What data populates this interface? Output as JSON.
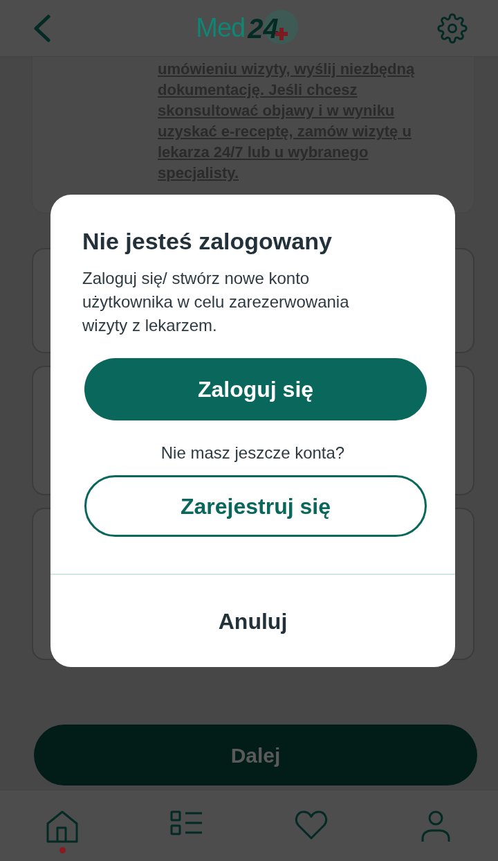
{
  "header": {
    "logo": {
      "text": "Med",
      "number": "24"
    }
  },
  "content": {
    "paragraph": "umówieniu wizyty, wyślij niezbędną dokumentację. Jeśli chcesz skonsultować objawy i w wyniku uzyskać e-receptę, zamów wizytę u lekarza 24/7 lub u wybranego specjalisty."
  },
  "dialog": {
    "title": "Nie jesteś zalogowany",
    "message": "Zaloguj się/ stwórz nowe konto użytkownika w celu zarezerwowania wizyty z lekarzem.",
    "primary_button": "Zaloguj się",
    "prompt": "Nie masz jeszcze konta?",
    "secondary_button": "Zarejestruj się",
    "cancel_button": "Anuluj"
  },
  "next_button": {
    "label": "Dalej",
    "disabled": true
  },
  "bottom_nav": [
    {
      "kind": "home",
      "selected": true
    },
    {
      "kind": "list",
      "selected": false
    },
    {
      "kind": "heart",
      "selected": false
    },
    {
      "kind": "person",
      "selected": false
    }
  ]
}
